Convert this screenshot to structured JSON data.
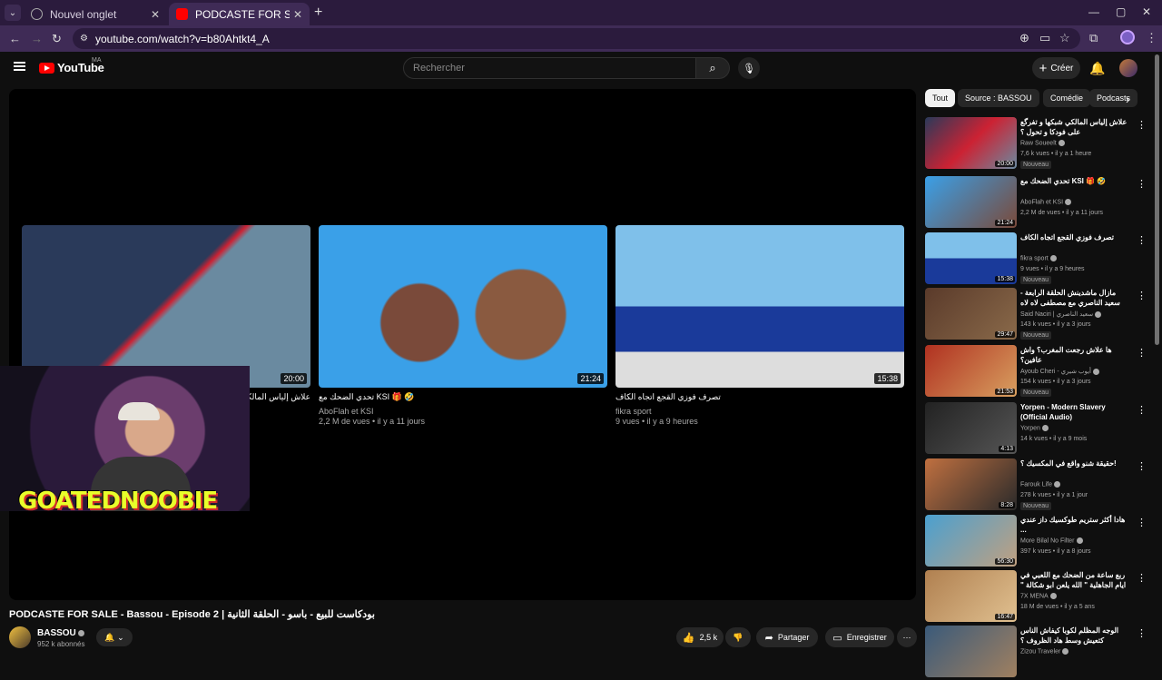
{
  "browser": {
    "tabs": [
      {
        "label": "Nouvel onglet",
        "active": false
      },
      {
        "label": "PODCASTE FOR SALE - Bassou",
        "active": true
      }
    ],
    "url": "youtube.com/watch?v=b80Ahtkt4_A"
  },
  "header": {
    "logo_text": "YouTube",
    "country_code": "MA",
    "search_placeholder": "Rechercher",
    "create_label": "Créer"
  },
  "player": {
    "end_cards": [
      {
        "title": "علاش إلياس المالكي شبكها و تفرگع على فودكا و تحول ؟",
        "channel": "Raw Soueelt",
        "meta": "7,6 k vues • il y a 1 heure",
        "duration": "20:00"
      },
      {
        "title": "تحدي الضحك مع KSI 🎁 🤣",
        "channel": "AboFlah et KSI",
        "meta": "2,2 M de vues • il y a 11 jours",
        "duration": "21:24"
      },
      {
        "title": "تصرف فوزي القجع اتجاه الكاف",
        "channel": "fikra sport",
        "meta": "9 vues • il y a 9 heures",
        "duration": "15:38"
      }
    ],
    "overlay_text": "GOATEDNOOBIE"
  },
  "video": {
    "title": "PODCASTE FOR SALE - Bassou - Episode 2 | بودكاست للبيع - باسو - الحلقة الثانية",
    "channel_name": "BASSOU",
    "subscribers": "952 k abonnés",
    "likes": "2,5 k",
    "share_label": "Partager",
    "save_label": "Enregistrer"
  },
  "chips": [
    "Tout",
    "Source : BASSOU",
    "Comédie",
    "Podcasts"
  ],
  "recommendations": [
    {
      "title": "علاش إلياس المالكي شبكها و تفرگع على فودكا و تحول ؟",
      "channel": "Raw Soueelt",
      "meta": "7,6 k vues • il y a 1 heure",
      "badge": "Nouveau",
      "duration": "20:00"
    },
    {
      "title": "تحدي الضحك مع KSI 🎁 🤣",
      "channel": "AboFlah et KSI",
      "meta": "2,2 M de vues • il y a 11 jours",
      "badge": "",
      "duration": "21:24"
    },
    {
      "title": "تصرف فوزي القجع اتجاه الكاف",
      "channel": "fikra sport",
      "meta": "9 vues • il y a 9 heures",
      "badge": "Nouveau",
      "duration": "15:38"
    },
    {
      "title": "مازال ماشدينش الحلقة الرابعة - سعيد الناصري مع مصطفى لاه لاه",
      "channel": "Said Naciri | سعيد الناصري",
      "meta": "143 k vues • il y a 3 jours",
      "badge": "Nouveau",
      "duration": "29:47"
    },
    {
      "title": "ها علاش رجعت المغرب؟ واش عافين؟",
      "channel": "Ayoub Cheri - أيوب شيري",
      "meta": "154 k vues • il y a 3 jours",
      "badge": "Nouveau",
      "duration": "21:53"
    },
    {
      "title": "Yorpen - Modern Slavery (Official Audio)",
      "channel": "Yorpen",
      "meta": "14 k vues • il y a 9 mois",
      "badge": "",
      "duration": "4:13"
    },
    {
      "title": "حقيقة شنو واقع في المكسيك ؟!",
      "channel": "Farouk Life",
      "meta": "278 k vues • il y a 1 jour",
      "badge": "Nouveau",
      "duration": "8:28"
    },
    {
      "title": "هادا أكثر ستريم طوكسيك داز عندي ...",
      "channel": "More Bilal No Filter",
      "meta": "397 k vues • il y a 8 jours",
      "badge": "",
      "duration": "56:30"
    },
    {
      "title": "ربع ساعة من الضحك مع اللعبي في ايام الجاهلية \" الله يلعن ابو شكالة \" 😂 هضرو ...",
      "channel": "7X MENA",
      "meta": "18 M de vues • il y a 5 ans",
      "badge": "",
      "duration": "16:47"
    },
    {
      "title": "الوجه المظلم لكوبا كيفاش الناس كتعيش وسط هاد الظروف ؟",
      "channel": "Zizou Traveler",
      "meta": "",
      "badge": "",
      "duration": ""
    }
  ]
}
